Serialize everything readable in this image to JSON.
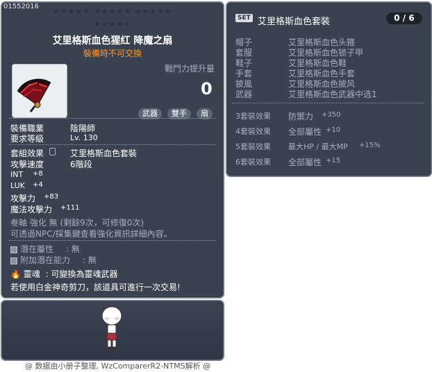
{
  "item": {
    "id": "01552016",
    "name": "艾里格斯血色猩红  降魔之扇",
    "trade_note": "裝備時不可交換",
    "combat_power_label": "戰鬥力提升量",
    "combat_power_value": "0",
    "tags": [
      "武器",
      "雙手",
      "扇"
    ],
    "job_label": "裝備職業",
    "job_value": "陰陽師",
    "level_label": "要求等級",
    "level_value": "Lv. 130",
    "set_label": "套組效果",
    "set_value": "艾里格斯血色套裝",
    "speed_label": "攻擊速度",
    "speed_value": "6階段",
    "stats": [
      {
        "label": "INT",
        "value": "+8"
      },
      {
        "label": "LUK",
        "value": "+4"
      },
      {
        "label": "攻擊力",
        "value": "+83"
      },
      {
        "label": "魔法攻擊力",
        "value": "+111"
      }
    ],
    "enhance_line1": "卷軸 強化 無 (剩餘9次，可修復0次)",
    "enhance_line2": "可透過NPC/採集鍵查看強化資訊詳細內容。",
    "potential_label": "潛在屬性",
    "potential_value": ": 無",
    "addpotential_label": "附加潛在能力",
    "addpotential_value": ": 無",
    "soul_label": "靈魂",
    "soul_value": ": 可變換為靈魂武器",
    "scissors_note": "若使用白金神奇剪刀，該道具可進行一次交易!"
  },
  "set_panel": {
    "badge": "SET",
    "title": "艾里格斯血色套裝",
    "count": "0 / 6",
    "pieces": [
      {
        "slot": "帽子",
        "name": "艾里格斯血色头箍"
      },
      {
        "slot": "套服",
        "name": "艾里格斯血色锁子甲"
      },
      {
        "slot": "鞋子",
        "name": "艾里格斯血色鞋"
      },
      {
        "slot": "手套",
        "name": "艾里格斯血色手套"
      },
      {
        "slot": "披風",
        "name": "艾里格斯血色披风"
      },
      {
        "slot": "武器",
        "name": "艾里格斯血色武器中选1"
      }
    ],
    "effects": [
      {
        "tier": "3套裝效果",
        "stat": "防禦力",
        "value": "+350"
      },
      {
        "tier": "4套裝效果",
        "stat": "全部屬性",
        "value": "+10"
      },
      {
        "tier": "5套裝效果",
        "stat": "最大HP / 最大MP",
        "value": "+15%"
      },
      {
        "tier": "6套裝效果",
        "stat": "全部屬性",
        "value": "+15"
      }
    ]
  },
  "credit": "@ 数据由小册子整理, WzComparerR2-NTMS解析 @",
  "colors": {
    "panel": "#3a4250",
    "accent_orange": "#ff9a2a",
    "gray_text": "#a8b0bc"
  },
  "icons": [
    "fan-weapon-icon",
    "lock-icon",
    "soul-flame-icon",
    "character-sprite"
  ]
}
